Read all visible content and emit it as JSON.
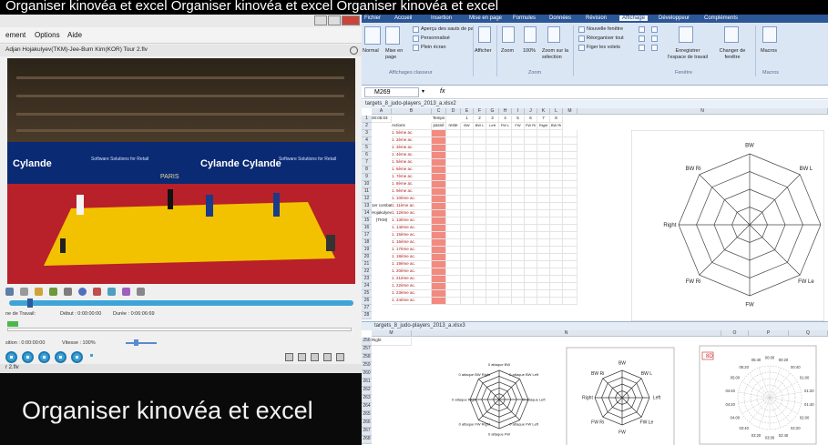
{
  "caption": {
    "top_text": "Organiser kinovéa et excel Organiser kinovéa et excel Organiser kinovéa et excel",
    "bottom_text": "Organiser kinovéa et excel"
  },
  "kinovea": {
    "menu": [
      "ement",
      "Options",
      "Aide"
    ],
    "file_name": "Adjan Hojakulyev(TKM)-Jee-Bum Kim(KOR) Tour 2.flv",
    "banner_texts": [
      "Cylande",
      "Software Solutions for Retail",
      "Cylande",
      "Cylande",
      "Software Solutions for Retail",
      "PARIS"
    ],
    "workspace_label": "ne de Travail:",
    "start_label": "Début : 0:00:00:00",
    "duration_label": "Durée : 0:06:06:69",
    "position_label": "sition : 0:00:00:00",
    "speed_label": "Vitesse : 100%",
    "status": "r 2.flv"
  },
  "excel": {
    "tabs": [
      "Fichier",
      "Accueil",
      "Insertion",
      "Mise en page",
      "Formules",
      "Données",
      "Révision",
      "Affichage",
      "Développeur",
      "Compléments"
    ],
    "active_tab": "Affichage",
    "ribbon": {
      "normal": "Normal",
      "mise_en_page": "Mise en page",
      "apercu": "Aperçu des sauts de pa",
      "personnalise": "Personnalisé",
      "plein_ecran": "Plein écran",
      "group_affichages": "Affichages classeur",
      "afficher": "Afficher",
      "zoom": "Zoom",
      "zoom_100": "100%",
      "zoom_selection": "Zoom sur la sélection",
      "group_zoom": "Zoom",
      "nouvelle_fenetre": "Nouvelle fenêtre",
      "reorganiser": "Réorganiser tout",
      "figer": "Figer les volets",
      "enregistrer": "Enregistrer l'espace de travail",
      "changer": "Changer de fenêtre",
      "group_fenetre": "Fenêtre",
      "macros": "Macros",
      "group_macros": "Macros"
    },
    "name_box": "M269",
    "fx": "fx",
    "workbook1": "targets_8_judo-players_2013_a.xlsx2",
    "cols": [
      "A",
      "B",
      "C",
      "D",
      "E",
      "F",
      "G",
      "H",
      "I",
      "J",
      "K",
      "L",
      "M",
      "N"
    ],
    "row1": {
      "a": "00:05:03",
      "c": "Temps",
      "nums": [
        "1",
        "2",
        "3",
        "4",
        "5",
        "6",
        "7",
        "8"
      ]
    },
    "row2": {
      "b": "Actions",
      "c": "passé",
      "d": "reste",
      "heads": [
        "BW",
        "BW L",
        "Left",
        "FW L",
        "FW",
        "FW Ri",
        "Right",
        "BW Ri"
      ]
    },
    "actions": [
      "1. 5ème ac.",
      "1. 2ème ac.",
      "1. 3ème ac.",
      "1. 4ème ac.",
      "1. 5ème ac.",
      "1. 6ème ac.",
      "1. 7ème ac.",
      "1. 8ème ac.",
      "1. 9ème ac.",
      "1. 10ème ac.",
      "1. 11ème ac.",
      "1. 12ème ac.",
      "1. 13ème ac.",
      "1. 14ème ac.",
      "1. 15ème ac.",
      "1. 16ème ac.",
      "1. 17ème ac.",
      "1. 18ème ac.",
      "1. 19ème ac.",
      "1. 20ème ac.",
      "1. 21ème ac.",
      "1. 22ème ac.",
      "1. 23ème ac.",
      "1. 24ème ac."
    ],
    "player_label": [
      "1er combat",
      "Hojakulyev",
      "(TKM)"
    ],
    "sm_label": "SM",
    "radar_main": {
      "labels": [
        "BW",
        "BW L",
        "Left",
        "FW Le",
        "FW",
        "FW Ri",
        "Right",
        "BW Ri"
      ]
    },
    "workbook2": "targets_8_judo-players_2013_a.xlsx3",
    "cols2": [
      "M",
      "N",
      "O",
      "P",
      "Q"
    ],
    "rows2": [
      "256",
      "257",
      "258",
      "259",
      "260",
      "261",
      "262",
      "263",
      "264",
      "265",
      "266",
      "267",
      "268"
    ],
    "row256_label": "Right",
    "radar_small1": {
      "labels": [
        "0 attaque BW",
        "0 attaque BW Left",
        "0 attaque Left",
        "0 attaque FW Left",
        "0 attaque FW",
        "0 attaque FW Right",
        "0 attaque Right",
        "0 attaque BW Right"
      ]
    },
    "radar_small2": {
      "labels": [
        "BW",
        "BW L",
        "Left",
        "FW Le",
        "FW",
        "FW Ri",
        "Right",
        "BW Ri"
      ]
    },
    "clock": {
      "badge": "8D",
      "labels": [
        "00:00",
        "00:20",
        "00:40",
        "01:00",
        "01:20",
        "01:40",
        "02:00",
        "02:20",
        "02:40",
        "03:00",
        "03:20",
        "03:40",
        "04:00",
        "04:20",
        "04:40",
        "05:00",
        "05:20",
        "05:40"
      ]
    }
  }
}
